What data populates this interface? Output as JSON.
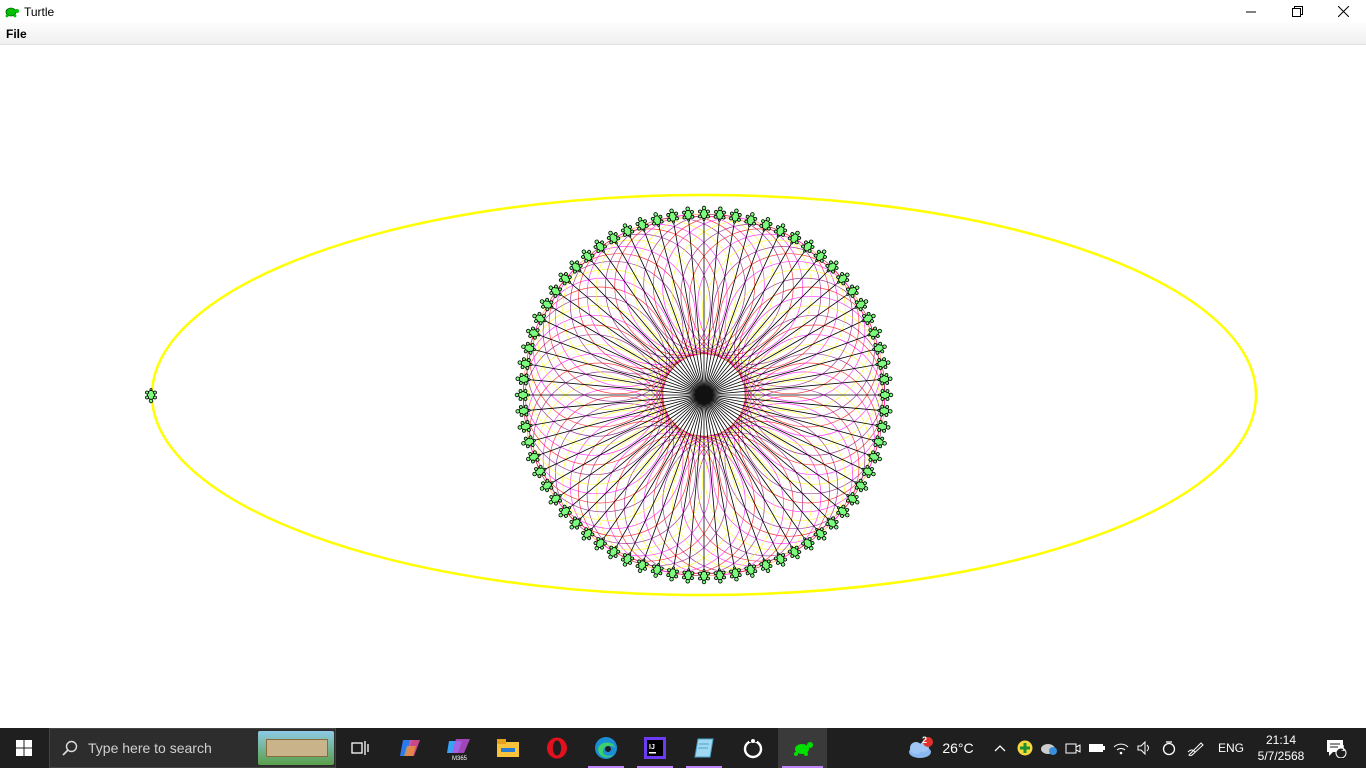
{
  "window": {
    "title": "Turtle",
    "menu": [
      "File"
    ]
  },
  "drawing": {
    "turtle_count": 72,
    "outer_ellipse_color": "#ffff00",
    "spoke_color": "#000000",
    "loop_colors": [
      "#ff0000",
      "#ff00ff",
      "#ffff00",
      "#800080"
    ],
    "turtle_fill": "#7cfc7c"
  },
  "taskbar": {
    "search_placeholder": "Type here to search",
    "weather_temp": "26°C",
    "weather_badge": "2",
    "language": "ENG",
    "time": "21:14",
    "date": "5/7/2568",
    "notification_count": "1",
    "apps": [
      "task-view-icon",
      "copilot-icon",
      "m365-icon",
      "file-explorer-icon",
      "opera-icon",
      "edge-icon",
      "intellij-icon",
      "notepad-icon",
      "obs-icon",
      "turtle-icon"
    ]
  }
}
